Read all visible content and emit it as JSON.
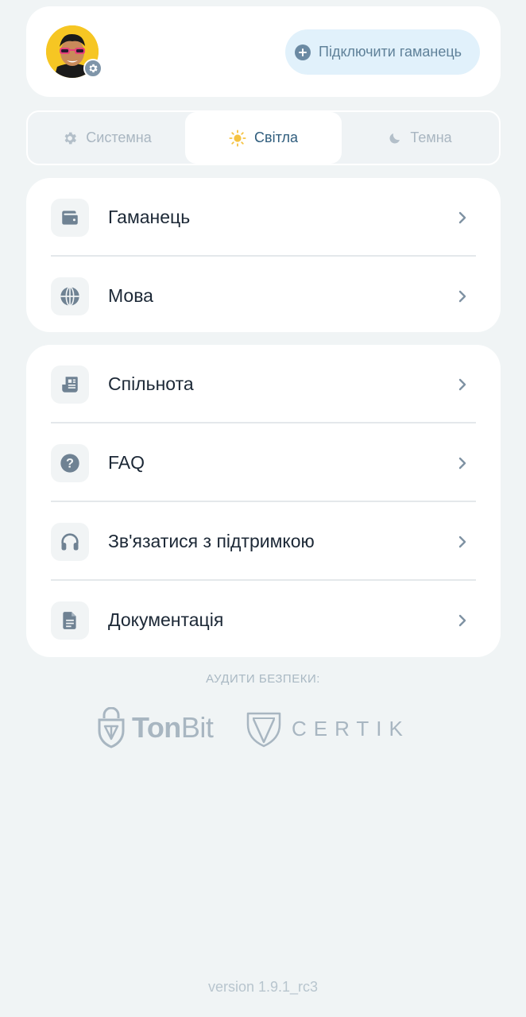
{
  "profile": {
    "avatar_icon": "avatar-image",
    "badge_icon": "gear-icon",
    "connect_button": {
      "icon": "plus-circle-icon",
      "label": "Підключити гаманець"
    }
  },
  "theme": {
    "options": [
      {
        "label": "Системна",
        "icon": "gear-icon",
        "active": false
      },
      {
        "label": "Світла",
        "icon": "sun-icon",
        "active": true
      },
      {
        "label": "Темна",
        "icon": "moon-icon",
        "active": false
      }
    ]
  },
  "menu_group_1": {
    "items": [
      {
        "label": "Гаманець",
        "icon": "wallet-icon"
      },
      {
        "label": "Мова",
        "icon": "globe-icon"
      }
    ]
  },
  "menu_group_2": {
    "items": [
      {
        "label": "Спільнота",
        "icon": "newspaper-icon"
      },
      {
        "label": "FAQ",
        "icon": "question-icon"
      },
      {
        "label": "Зв'язатися з підтримкою",
        "icon": "headphones-icon"
      },
      {
        "label": "Документація",
        "icon": "document-icon"
      }
    ]
  },
  "audits": {
    "title": "АУДИТИ БЕЗПЕКИ:",
    "tonbit": {
      "part1": "Ton",
      "part2": "Bit"
    },
    "certik": "CERTIK"
  },
  "version": "version 1.9.1_rc3",
  "colors": {
    "background": "#f0f4f5",
    "card": "#ffffff",
    "accent": "#2f5d7d",
    "connect_bg": "#e1f1fb",
    "icon": "#6f8293",
    "muted": "#a9b6c1"
  }
}
